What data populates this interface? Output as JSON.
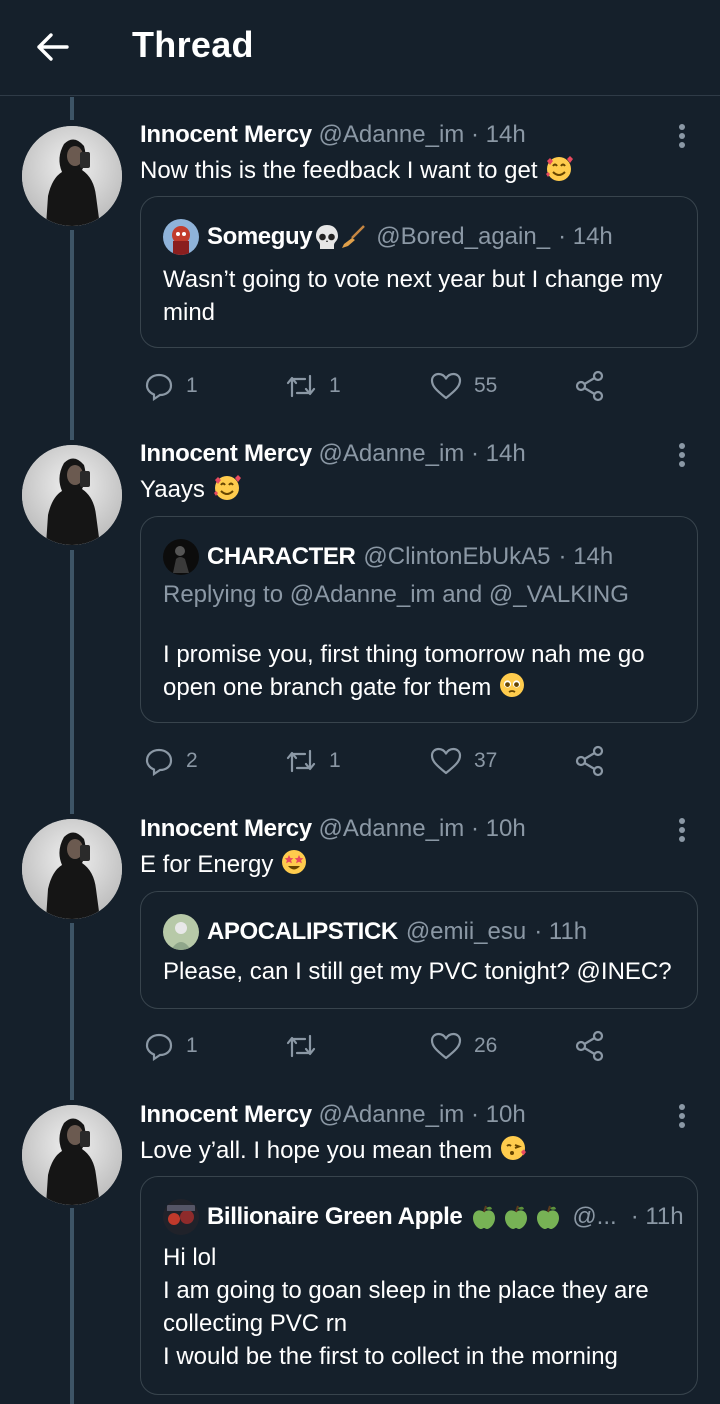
{
  "header": {
    "title": "Thread",
    "back_icon": "arrow-left-icon"
  },
  "colors": {
    "background": "#15202b",
    "border": "#38444d",
    "muted": "#8b98a5",
    "thread_line": "#3d5466"
  },
  "tweets": [
    {
      "author": {
        "name": "Innocent Mercy",
        "handle": "@Adanne_im",
        "time": "· 14h"
      },
      "text": "Now this is the feedback I want to get",
      "emoji": "smiling-face-with-hearts",
      "quote": {
        "name": "Someguy",
        "name_emojis": [
          "skull",
          "broom"
        ],
        "handle": "@Bored_again_",
        "time": "· 14h",
        "text": "Wasn’t going to vote next year but I change my mind"
      },
      "actions": {
        "replies": "1",
        "retweets": "1",
        "likes": "55"
      }
    },
    {
      "author": {
        "name": "Innocent Mercy",
        "handle": "@Adanne_im",
        "time": "· 14h"
      },
      "text": "Yaays",
      "emoji": "smiling-face-with-hearts",
      "quote": {
        "name": "CHARACTER",
        "handle": "@ClintonEbUkA5",
        "time": "· 14h",
        "replying_to": "Replying to @Adanne_im and @_VALKING",
        "text": "I promise you, first thing tomorrow nah me go open one branch gate for them",
        "text_emoji": "pleading-face"
      },
      "actions": {
        "replies": "2",
        "retweets": "1",
        "likes": "37"
      }
    },
    {
      "author": {
        "name": "Innocent Mercy",
        "handle": "@Adanne_im",
        "time": "· 10h"
      },
      "text": "E for Energy",
      "emoji": "star-struck",
      "quote": {
        "name": "APOCALIPSTICK",
        "handle": "@emii_esu",
        "time": "· 11h",
        "text": "Please, can I still get my PVC tonight? @INEC?"
      },
      "actions": {
        "replies": "1",
        "retweets": "",
        "likes": "26"
      }
    },
    {
      "author": {
        "name": "Innocent Mercy",
        "handle": "@Adanne_im",
        "time": "· 10h"
      },
      "text": "Love y’all. I hope you mean them",
      "emoji": "face-blowing-a-kiss",
      "quote": {
        "name": "Billionaire Green Apple",
        "name_emojis": [
          "green-apple",
          "green-apple",
          "green-apple"
        ],
        "handle": "@...",
        "time": "· 11h",
        "text_lines": [
          "Hi lol",
          "I am going to goan sleep in the place they are",
          "collecting PVC rn",
          "I would be the first to collect in the morning"
        ]
      }
    }
  ]
}
